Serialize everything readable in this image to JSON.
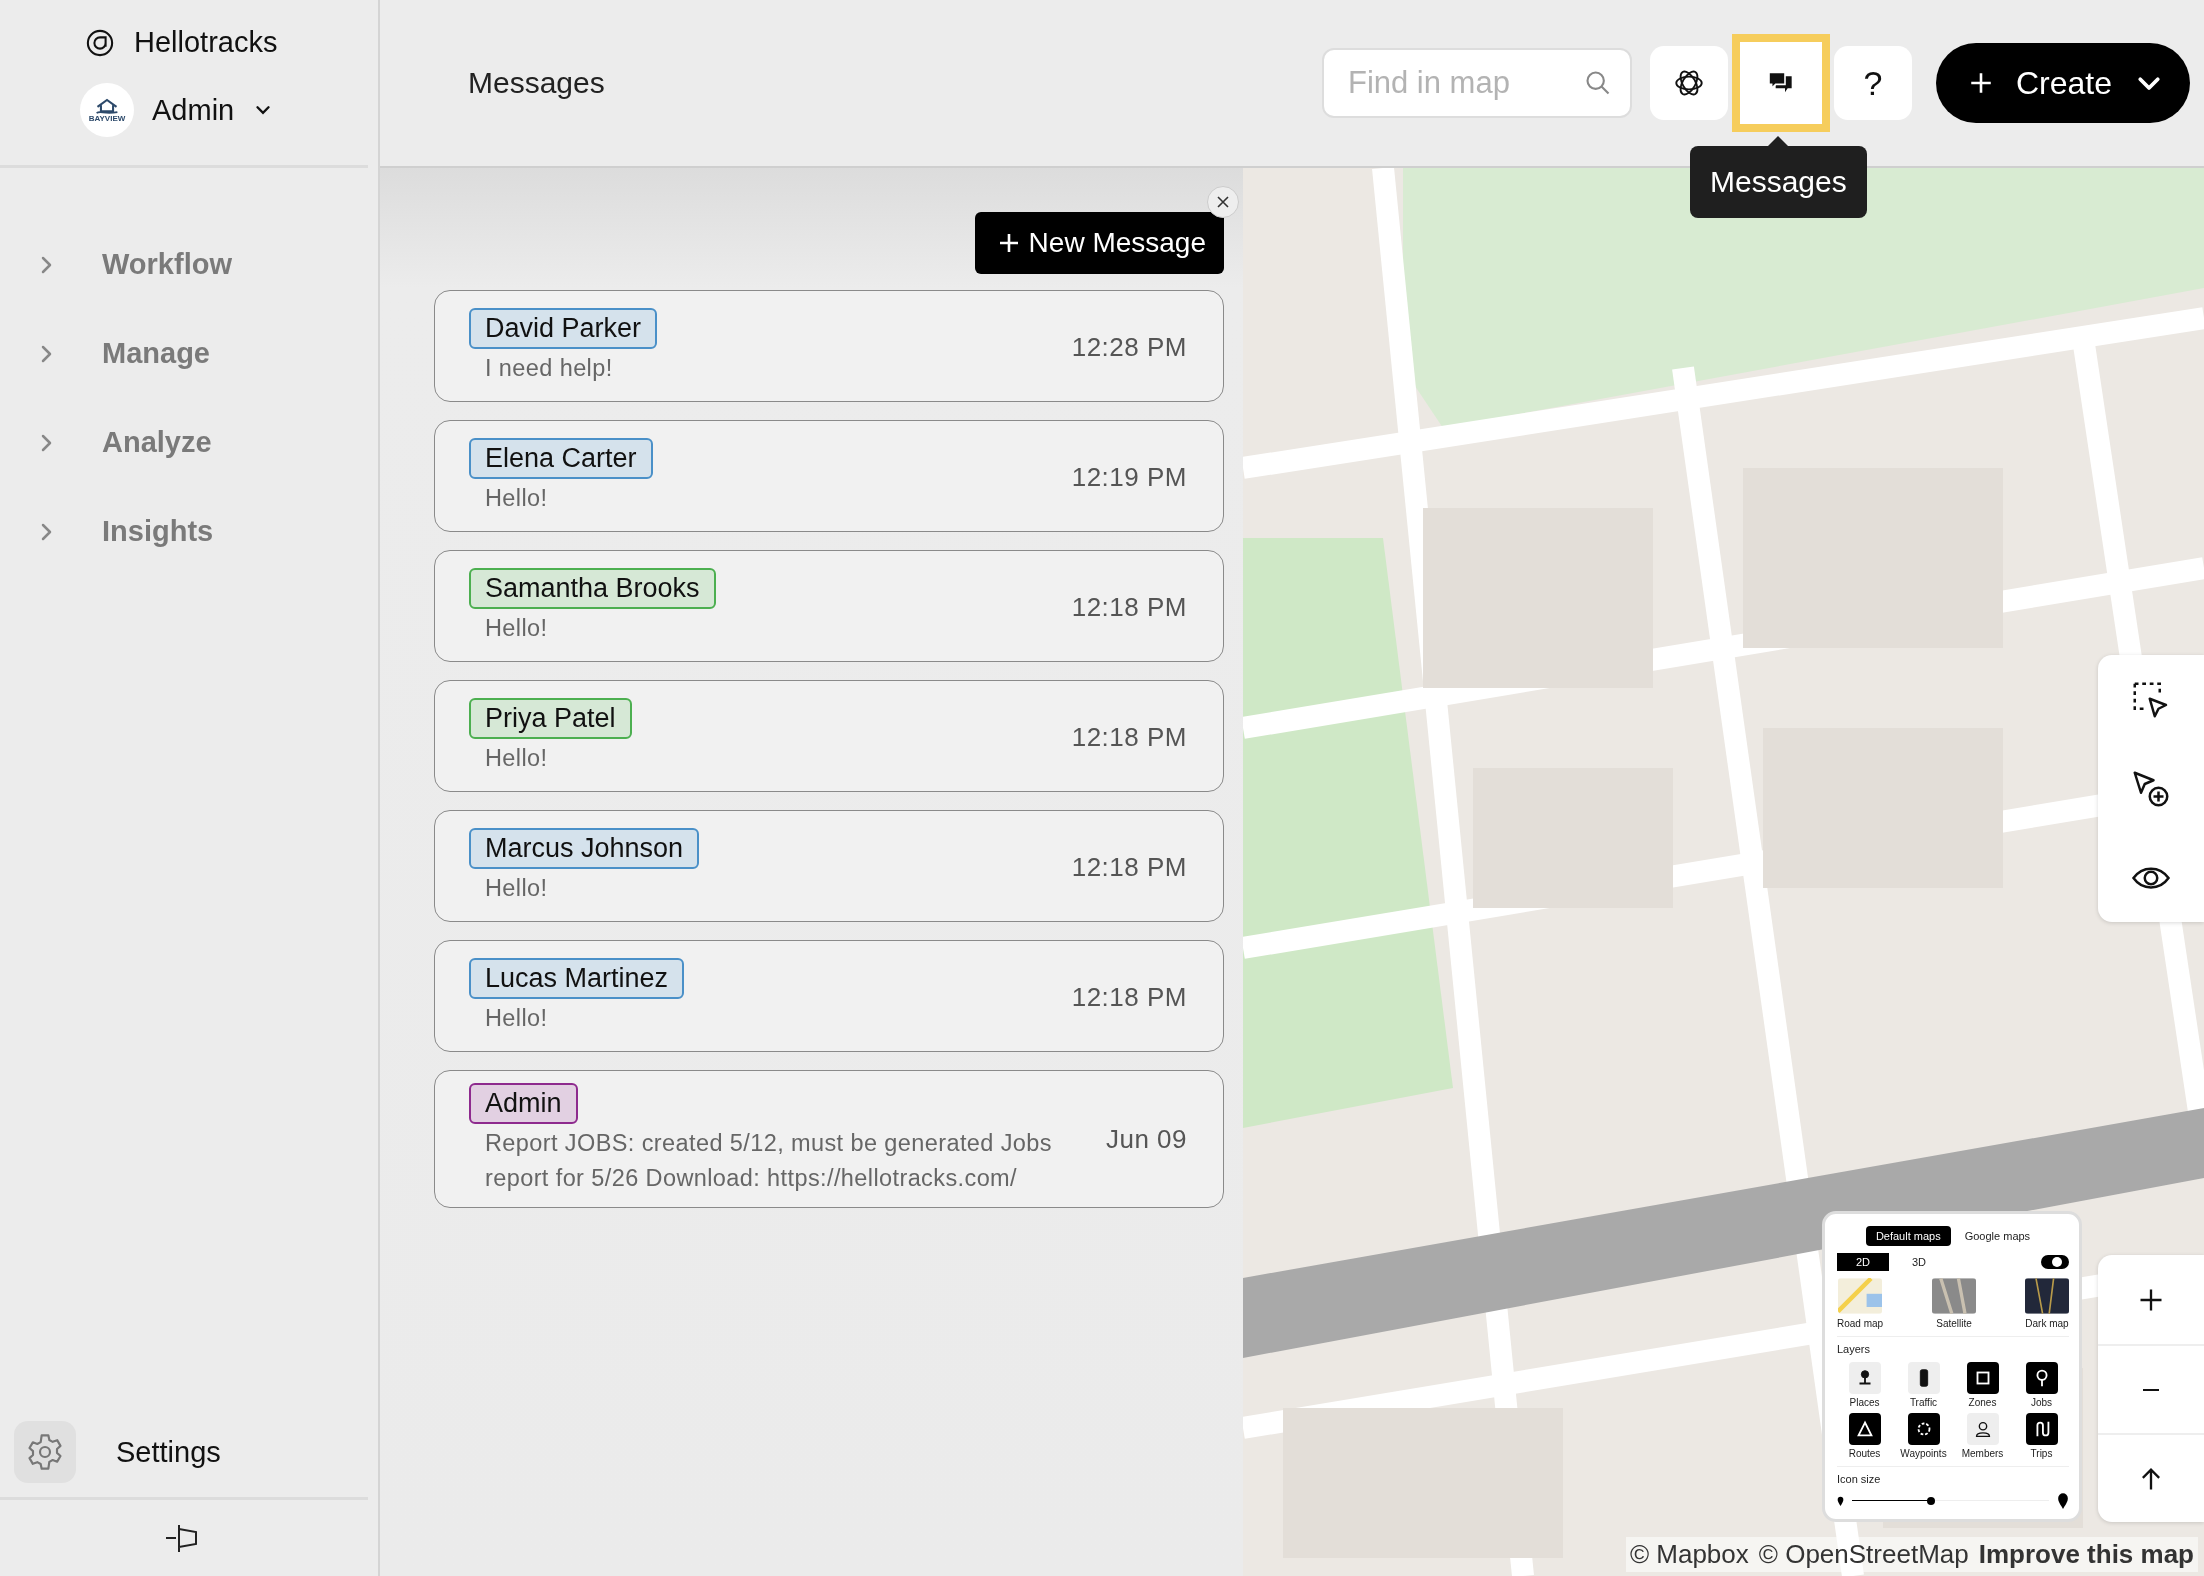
{
  "sidebar": {
    "brand": "Hellotracks",
    "account": {
      "logo_text": "BAYVIEW",
      "name": "Admin"
    },
    "nav": [
      {
        "label": "Workflow",
        "expanded": false
      },
      {
        "label": "Manage",
        "expanded": false
      },
      {
        "label": "Analyze",
        "expanded": false
      },
      {
        "label": "Insights",
        "expanded": false
      }
    ],
    "settings": "Settings"
  },
  "header": {
    "title": "Messages",
    "search": {
      "placeholder": "Find in map"
    },
    "tools": [
      {
        "kind": "assistant",
        "selected": false
      },
      {
        "kind": "messages",
        "selected": true
      },
      {
        "kind": "help",
        "label": "?",
        "selected": false
      }
    ],
    "create": "Create",
    "tooltip": "Messages"
  },
  "messages_panel": {
    "new_message": "New Message",
    "messages": [
      {
        "name": "David Parker",
        "color": "#4a90c8",
        "preview": "I need help!",
        "time": "12:28 PM"
      },
      {
        "name": "Elena Carter",
        "color": "#4a90c8",
        "preview": "Hello!",
        "time": "12:19 PM"
      },
      {
        "name": "Samantha Brooks",
        "color": "#4caf50",
        "preview": "Hello!",
        "time": "12:18 PM"
      },
      {
        "name": "Priya Patel",
        "color": "#4caf50",
        "preview": "Hello!",
        "time": "12:18 PM"
      },
      {
        "name": "Marcus Johnson",
        "color": "#4a90c8",
        "preview": "Hello!",
        "time": "12:18 PM"
      },
      {
        "name": "Lucas Martinez",
        "color": "#4a90c8",
        "preview": "Hello!",
        "time": "12:18 PM"
      },
      {
        "name": "Admin",
        "color": "#8e2a8e",
        "preview": "Report JOBS: created 5/12, must be generated Jobs report for 5/26 Download: https://hellotracks.com/",
        "time": "Jun 09"
      }
    ]
  },
  "map": {
    "layers_panel": {
      "tabs": [
        {
          "label": "Default maps",
          "selected": true
        },
        {
          "label": "Google maps",
          "selected": false
        }
      ],
      "modes": [
        {
          "label": "2D",
          "selected": true
        },
        {
          "label": "3D",
          "selected": false
        }
      ],
      "toggle": {
        "on": true
      },
      "styles": [
        {
          "kind": "road",
          "label": "Road map"
        },
        {
          "kind": "satellite",
          "label": "Satellite"
        },
        {
          "kind": "dark",
          "label": "Dark map"
        }
      ],
      "layers_title": "Layers",
      "layers": [
        {
          "kind": "places",
          "label": "Places",
          "on": false
        },
        {
          "kind": "traffic",
          "label": "Traffic",
          "on": false
        },
        {
          "kind": "zones",
          "label": "Zones",
          "on": true
        },
        {
          "kind": "jobs",
          "label": "Jobs",
          "on": true
        },
        {
          "kind": "routes",
          "label": "Routes",
          "on": true
        },
        {
          "kind": "waypoints",
          "label": "Waypoints",
          "on": true
        },
        {
          "kind": "members",
          "label": "Members",
          "on": false
        },
        {
          "kind": "trips",
          "label": "Trips",
          "on": true
        }
      ],
      "icon_size_title": "Icon size",
      "icon_size": {
        "level": 0.4
      }
    },
    "attribution": [
      {
        "kind": "plain",
        "text": "© Mapbox"
      },
      {
        "kind": "plain",
        "text": "© OpenStreetMap"
      },
      {
        "kind": "strong",
        "text": "Improve this map"
      }
    ]
  }
}
